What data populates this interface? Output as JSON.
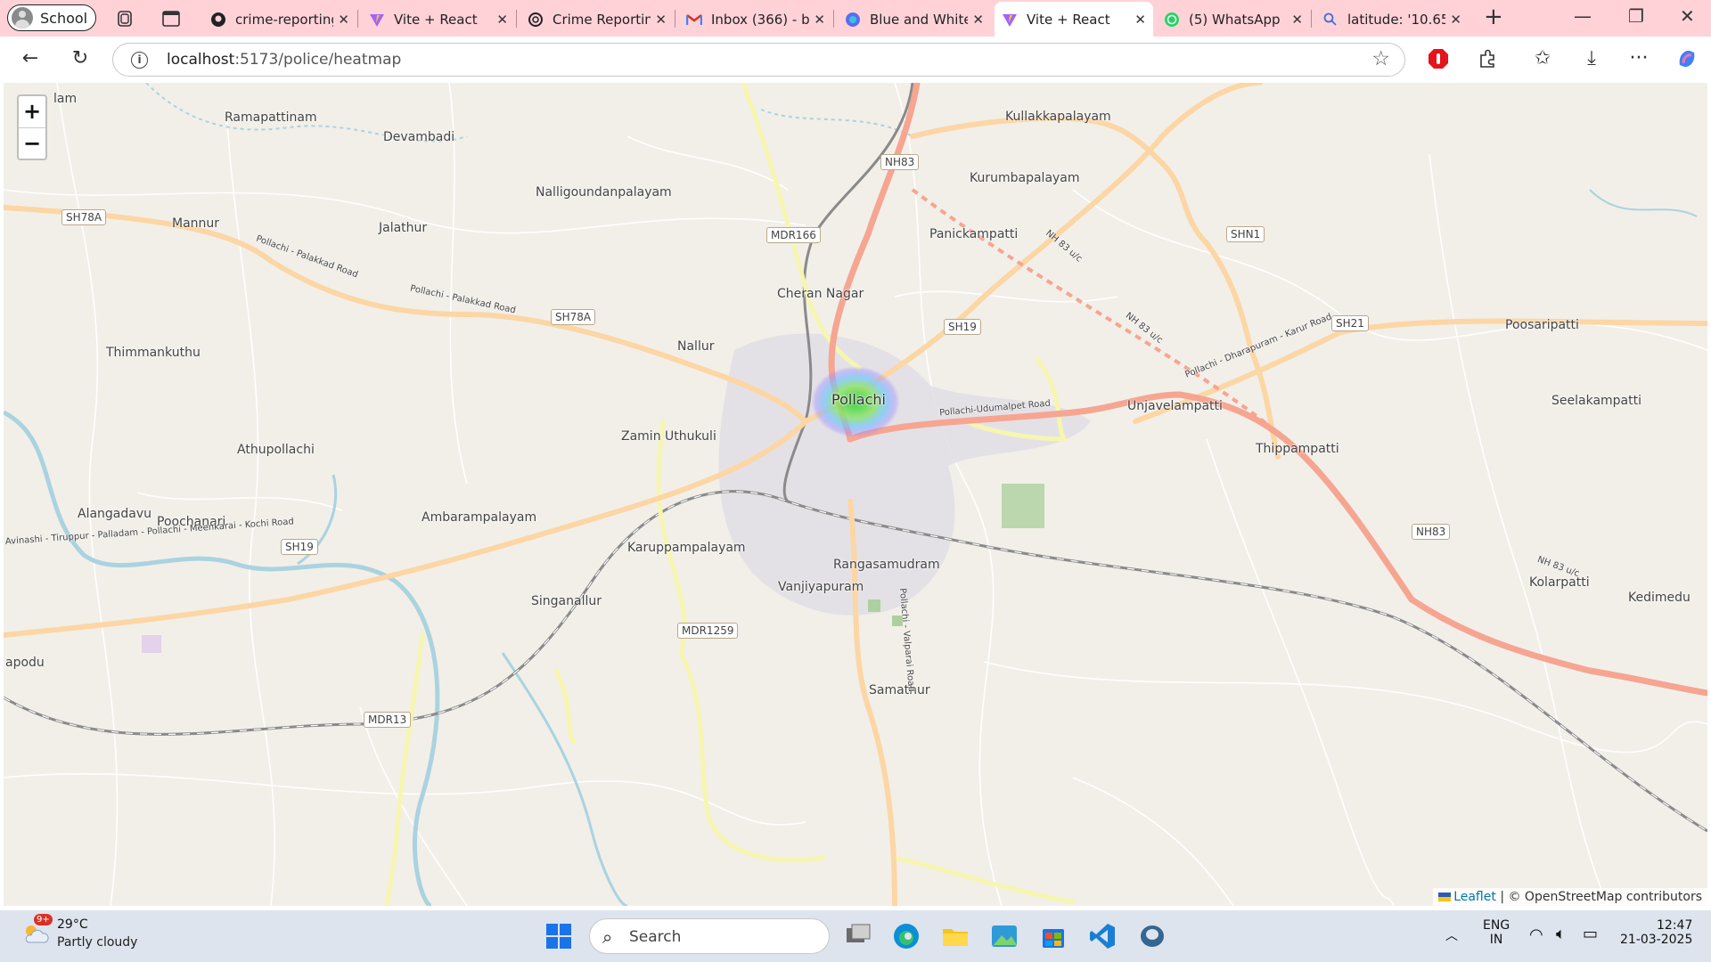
{
  "browser": {
    "profile": "School",
    "tabs": [
      {
        "title": "crime-reporting",
        "icon": "github-icon"
      },
      {
        "title": "Vite + React",
        "icon": "vite-icon"
      },
      {
        "title": "Crime Reporting",
        "icon": "openai-icon"
      },
      {
        "title": "Inbox (366) - b",
        "icon": "gmail-icon"
      },
      {
        "title": "Blue and White",
        "icon": "canva-icon"
      },
      {
        "title": "Vite + React",
        "icon": "vite-icon",
        "active": true
      },
      {
        "title": "(5) WhatsApp",
        "icon": "whatsapp-icon"
      },
      {
        "title": "latitude: '10.65",
        "icon": "search-icon"
      }
    ],
    "address": {
      "host": "localhost",
      "path": ":5173/police/heatmap"
    }
  },
  "map": {
    "zoom_in": "+",
    "zoom_out": "−",
    "places": {
      "pollachi": "Pollachi",
      "ramapattinam": "Ramapattinam",
      "devambadi": "Devambadi",
      "nalligoundanpalayam": "Nalligoundanpalayam",
      "kullakkapalayam": "Kullakkapalayam",
      "kurumbapalayam": "Kurumbapalayam",
      "mannur": "Mannur",
      "jalathur": "Jalathur",
      "panickampatti": "Panickampatti",
      "cheran_nagar": "Cheran Nagar",
      "nallur": "Nallur",
      "thimmankuthu": "Thimmankuthu",
      "poosaripatti": "Poosaripatti",
      "unjavelampatti": "Unjavelampatti",
      "seelakampatti": "Seelakampatti",
      "zamin_uthukuli": "Zamin Uthukuli",
      "athupollachi": "Athupollachi",
      "thippampatti": "Thippampatti",
      "alangadavu": "Alangadavu",
      "poochanari": "Poochanari",
      "ambarampalayam": "Ambarampalayam",
      "karuppampalayam": "Karuppampalayam",
      "rangasamudram": "Rangasamudram",
      "vanjiyapuram": "Vanjiyapuram",
      "singanallur": "Singanallur",
      "kolarpatti": "Kolarpatti",
      "kedimedu": "Kedimedu",
      "samathur": "Samathur",
      "apodu": "apodu",
      "lam": "lam"
    },
    "roads": {
      "nh83_a": "NH83",
      "nh83_b": "NH83",
      "sh78a_a": "SH78A",
      "sh78a_b": "SH78A",
      "mdr166": "MDR166",
      "sh19_a": "SH19",
      "sh19_b": "SH19",
      "shn1": "SHN1",
      "sh21": "SH21",
      "mdr1259": "MDR1259",
      "mdr13": "MDR13"
    },
    "road_names": {
      "pollachi_palakkad_1": "Pollachi - Palakkad Road",
      "pollachi_palakkad_2": "Pollachi - Palakkad Road",
      "pollachi_udumalpet": "Pollachi-Udumalpet Road",
      "pollachi_dharapuram": "Pollachi - Dharapuram - Karur Road",
      "avinashi": "Avinashi - Tiruppur - Palladam - Pollachi - Meenkarai - Kochi Road",
      "pollachi_valparai": "Pollachi - Valparai Road",
      "nh83_uc_1": "NH 83 u/c",
      "nh83_uc_2": "NH 83 u/c",
      "nh83_uc_3": "NH 83 u/c"
    },
    "attribution": {
      "leaflet": "Leaflet",
      "osm": "| © OpenStreetMap contributors"
    },
    "heat_colors": [
      "#2fd33a",
      "#8ee36b",
      "#6fc6ff",
      "#9c8cff"
    ]
  },
  "taskbar": {
    "weather": {
      "temp": "29°C",
      "condition": "Partly cloudy",
      "badge": "9+"
    },
    "search_label": "Search",
    "lang": "ENG",
    "region": "IN",
    "time": "12:47",
    "date": "21-03-2025"
  }
}
